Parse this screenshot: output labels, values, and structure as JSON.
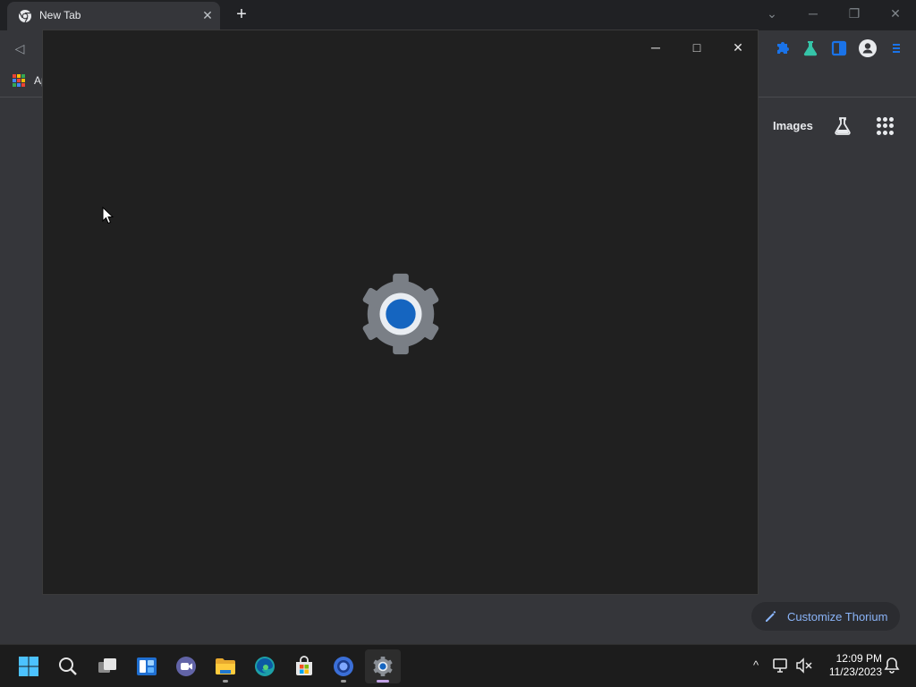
{
  "browser": {
    "tab": {
      "title": "New Tab",
      "close": "✕"
    },
    "new_tab": "+",
    "tab_search": "⌄",
    "window_controls": {
      "minimize": "─",
      "restore": "❐",
      "close": "✕"
    },
    "toolbar": {
      "back": "◁"
    },
    "bookmarks": {
      "apps_label": "Ap"
    },
    "ntp": {
      "images_link": "Images",
      "customize_label": "Customize Thorium"
    }
  },
  "dialog": {
    "controls": {
      "minimize": "─",
      "maximize": "□",
      "close": "✕"
    },
    "loading_icon": "gear-icon"
  },
  "taskbar": {
    "apps": [
      {
        "name": "start",
        "icon": "windows-start-icon"
      },
      {
        "name": "search",
        "icon": "search-icon"
      },
      {
        "name": "task-view",
        "icon": "task-view-icon"
      },
      {
        "name": "widgets",
        "icon": "widgets-icon"
      },
      {
        "name": "teams-chat",
        "icon": "chat-icon"
      },
      {
        "name": "file-explorer",
        "icon": "folder-icon"
      },
      {
        "name": "edge",
        "icon": "edge-icon"
      },
      {
        "name": "store",
        "icon": "store-icon"
      },
      {
        "name": "thorium",
        "icon": "thorium-icon"
      },
      {
        "name": "settings",
        "icon": "settings-gear-icon",
        "active": true
      }
    ],
    "tray": {
      "overflow": "^"
    },
    "clock": {
      "time": "12:09 PM",
      "date": "11/23/2023"
    }
  },
  "colors": {
    "accent_blue": "#8ab4f8",
    "gear_gray": "#7a7f86",
    "gear_blue": "#1565c0",
    "active_indicator": "#c2a3e6"
  }
}
